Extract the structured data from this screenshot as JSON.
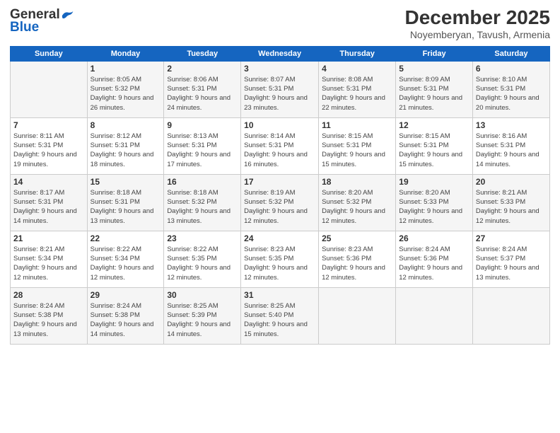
{
  "header": {
    "logo_general": "General",
    "logo_blue": "Blue",
    "title": "December 2025",
    "subtitle": "Noyemberyan, Tavush, Armenia"
  },
  "weekdays": [
    "Sunday",
    "Monday",
    "Tuesday",
    "Wednesday",
    "Thursday",
    "Friday",
    "Saturday"
  ],
  "weeks": [
    [
      {
        "day": "",
        "sunrise": "",
        "sunset": "",
        "daylight": ""
      },
      {
        "day": "1",
        "sunrise": "Sunrise: 8:05 AM",
        "sunset": "Sunset: 5:32 PM",
        "daylight": "Daylight: 9 hours and 26 minutes."
      },
      {
        "day": "2",
        "sunrise": "Sunrise: 8:06 AM",
        "sunset": "Sunset: 5:31 PM",
        "daylight": "Daylight: 9 hours and 24 minutes."
      },
      {
        "day": "3",
        "sunrise": "Sunrise: 8:07 AM",
        "sunset": "Sunset: 5:31 PM",
        "daylight": "Daylight: 9 hours and 23 minutes."
      },
      {
        "day": "4",
        "sunrise": "Sunrise: 8:08 AM",
        "sunset": "Sunset: 5:31 PM",
        "daylight": "Daylight: 9 hours and 22 minutes."
      },
      {
        "day": "5",
        "sunrise": "Sunrise: 8:09 AM",
        "sunset": "Sunset: 5:31 PM",
        "daylight": "Daylight: 9 hours and 21 minutes."
      },
      {
        "day": "6",
        "sunrise": "Sunrise: 8:10 AM",
        "sunset": "Sunset: 5:31 PM",
        "daylight": "Daylight: 9 hours and 20 minutes."
      }
    ],
    [
      {
        "day": "7",
        "sunrise": "Sunrise: 8:11 AM",
        "sunset": "Sunset: 5:31 PM",
        "daylight": "Daylight: 9 hours and 19 minutes."
      },
      {
        "day": "8",
        "sunrise": "Sunrise: 8:12 AM",
        "sunset": "Sunset: 5:31 PM",
        "daylight": "Daylight: 9 hours and 18 minutes."
      },
      {
        "day": "9",
        "sunrise": "Sunrise: 8:13 AM",
        "sunset": "Sunset: 5:31 PM",
        "daylight": "Daylight: 9 hours and 17 minutes."
      },
      {
        "day": "10",
        "sunrise": "Sunrise: 8:14 AM",
        "sunset": "Sunset: 5:31 PM",
        "daylight": "Daylight: 9 hours and 16 minutes."
      },
      {
        "day": "11",
        "sunrise": "Sunrise: 8:15 AM",
        "sunset": "Sunset: 5:31 PM",
        "daylight": "Daylight: 9 hours and 15 minutes."
      },
      {
        "day": "12",
        "sunrise": "Sunrise: 8:15 AM",
        "sunset": "Sunset: 5:31 PM",
        "daylight": "Daylight: 9 hours and 15 minutes."
      },
      {
        "day": "13",
        "sunrise": "Sunrise: 8:16 AM",
        "sunset": "Sunset: 5:31 PM",
        "daylight": "Daylight: 9 hours and 14 minutes."
      }
    ],
    [
      {
        "day": "14",
        "sunrise": "Sunrise: 8:17 AM",
        "sunset": "Sunset: 5:31 PM",
        "daylight": "Daylight: 9 hours and 14 minutes."
      },
      {
        "day": "15",
        "sunrise": "Sunrise: 8:18 AM",
        "sunset": "Sunset: 5:31 PM",
        "daylight": "Daylight: 9 hours and 13 minutes."
      },
      {
        "day": "16",
        "sunrise": "Sunrise: 8:18 AM",
        "sunset": "Sunset: 5:32 PM",
        "daylight": "Daylight: 9 hours and 13 minutes."
      },
      {
        "day": "17",
        "sunrise": "Sunrise: 8:19 AM",
        "sunset": "Sunset: 5:32 PM",
        "daylight": "Daylight: 9 hours and 12 minutes."
      },
      {
        "day": "18",
        "sunrise": "Sunrise: 8:20 AM",
        "sunset": "Sunset: 5:32 PM",
        "daylight": "Daylight: 9 hours and 12 minutes."
      },
      {
        "day": "19",
        "sunrise": "Sunrise: 8:20 AM",
        "sunset": "Sunset: 5:33 PM",
        "daylight": "Daylight: 9 hours and 12 minutes."
      },
      {
        "day": "20",
        "sunrise": "Sunrise: 8:21 AM",
        "sunset": "Sunset: 5:33 PM",
        "daylight": "Daylight: 9 hours and 12 minutes."
      }
    ],
    [
      {
        "day": "21",
        "sunrise": "Sunrise: 8:21 AM",
        "sunset": "Sunset: 5:34 PM",
        "daylight": "Daylight: 9 hours and 12 minutes."
      },
      {
        "day": "22",
        "sunrise": "Sunrise: 8:22 AM",
        "sunset": "Sunset: 5:34 PM",
        "daylight": "Daylight: 9 hours and 12 minutes."
      },
      {
        "day": "23",
        "sunrise": "Sunrise: 8:22 AM",
        "sunset": "Sunset: 5:35 PM",
        "daylight": "Daylight: 9 hours and 12 minutes."
      },
      {
        "day": "24",
        "sunrise": "Sunrise: 8:23 AM",
        "sunset": "Sunset: 5:35 PM",
        "daylight": "Daylight: 9 hours and 12 minutes."
      },
      {
        "day": "25",
        "sunrise": "Sunrise: 8:23 AM",
        "sunset": "Sunset: 5:36 PM",
        "daylight": "Daylight: 9 hours and 12 minutes."
      },
      {
        "day": "26",
        "sunrise": "Sunrise: 8:24 AM",
        "sunset": "Sunset: 5:36 PM",
        "daylight": "Daylight: 9 hours and 12 minutes."
      },
      {
        "day": "27",
        "sunrise": "Sunrise: 8:24 AM",
        "sunset": "Sunset: 5:37 PM",
        "daylight": "Daylight: 9 hours and 13 minutes."
      }
    ],
    [
      {
        "day": "28",
        "sunrise": "Sunrise: 8:24 AM",
        "sunset": "Sunset: 5:38 PM",
        "daylight": "Daylight: 9 hours and 13 minutes."
      },
      {
        "day": "29",
        "sunrise": "Sunrise: 8:24 AM",
        "sunset": "Sunset: 5:38 PM",
        "daylight": "Daylight: 9 hours and 14 minutes."
      },
      {
        "day": "30",
        "sunrise": "Sunrise: 8:25 AM",
        "sunset": "Sunset: 5:39 PM",
        "daylight": "Daylight: 9 hours and 14 minutes."
      },
      {
        "day": "31",
        "sunrise": "Sunrise: 8:25 AM",
        "sunset": "Sunset: 5:40 PM",
        "daylight": "Daylight: 9 hours and 15 minutes."
      },
      {
        "day": "",
        "sunrise": "",
        "sunset": "",
        "daylight": ""
      },
      {
        "day": "",
        "sunrise": "",
        "sunset": "",
        "daylight": ""
      },
      {
        "day": "",
        "sunrise": "",
        "sunset": "",
        "daylight": ""
      }
    ]
  ]
}
